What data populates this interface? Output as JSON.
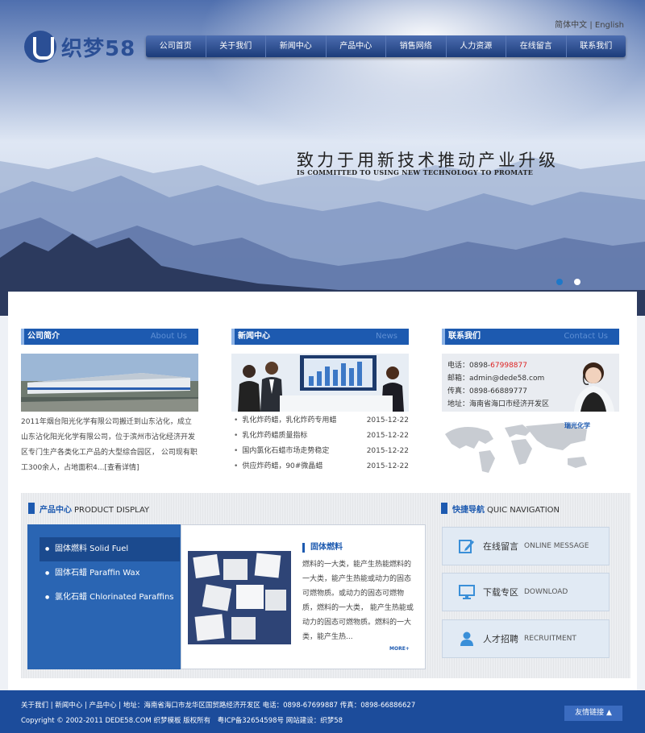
{
  "header": {
    "logo_text": "织梦58",
    "lang_cn": "简体中文",
    "lang_sep": "|",
    "lang_en": "English"
  },
  "nav": [
    "公司首页",
    "关于我们",
    "新闻中心",
    "产品中心",
    "销售网络",
    "人力资源",
    "在线留言",
    "联系我们"
  ],
  "banner": {
    "slogan": "致力于用新技术推动产业升级",
    "slogan_en": "IS COMMITTED TO USING NEW TECHNOLOGY TO PROMATE"
  },
  "about": {
    "title": "公司简介",
    "title_en": "About Us",
    "text": "2011年烟台阳光化学有限公司搬迁到山东沾化，成立山东沾化阳光化学有限公司，位于滨州市沾化经济开发区专门生产各类化工产品的大型综合园区， 公司现有职工300余人，占地面积4...",
    "more": "[查看详情]"
  },
  "news": {
    "title": "新闻中心",
    "title_en": "News",
    "items": [
      {
        "title": "乳化炸药蜡，乳化炸药专用蜡",
        "date": "2015-12-22"
      },
      {
        "title": "乳化炸药蜡质量指标",
        "date": "2015-12-22"
      },
      {
        "title": "国内氯化石蜡市场走势稳定",
        "date": "2015-12-22"
      },
      {
        "title": "供应炸药蜡，90#微晶蜡",
        "date": "2015-12-22"
      }
    ]
  },
  "contact": {
    "title": "联系我们",
    "title_en": "Contact Us",
    "phone_label": "电话：",
    "phone_prefix": "0898-",
    "phone_main": "67998877",
    "email": "邮箱：admin@dede58.com",
    "fax": "传真：0898-66889777",
    "address": "地址：海南省海口市经济开发区",
    "map_logo": "瑞光化学"
  },
  "products": {
    "title": "产品中心",
    "title_en": "PRODUCT DISPLAY",
    "categories": [
      "固体燃料 Solid Fuel",
      "固体石蜡 Paraffin Wax",
      "氯化石蜡 Chlorinated Paraffins"
    ],
    "active_title": "固体燃料",
    "active_desc": "燃料的一大类，能产生热能燃料的一大类，能产生热能或动力的固态可燃物质。或动力的固态可燃物质，燃料的一大类， 能产生热能或动力的固态可燃物质。燃料的一大类，能产生热...",
    "more": "MORE+"
  },
  "quicknav": {
    "title": "快捷导航",
    "title_en": "QUIC NAVIGATION",
    "items": [
      {
        "cn": "在线留言",
        "en": "ONLINE MESSAGE",
        "icon": "edit-icon"
      },
      {
        "cn": "下载专区",
        "en": "DOWNLOAD",
        "icon": "monitor-icon"
      },
      {
        "cn": "人才招聘",
        "en": "RECRUITMENT",
        "icon": "person-icon"
      }
    ]
  },
  "footer": {
    "links": [
      "关于我们",
      "新闻中心",
      "产品中心"
    ],
    "address": "地址：海南省海口市龙华区国贸路经济开发区 电话：0898-67699887 传真：0898-66886627",
    "copyright": "Copyright © 2002-2011 DEDE58.COM 织梦模板 版权所有　粤ICP备32654598号 网站建设：织梦58",
    "friend_links": "友情链接 ▲"
  },
  "colors": {
    "brand": "#1d5ab0",
    "footer": "#1c4c9b",
    "accent_red": "#dd2222"
  }
}
